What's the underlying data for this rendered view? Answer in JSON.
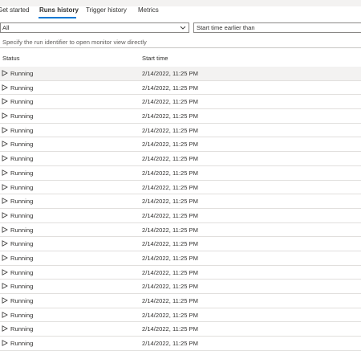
{
  "tabs": [
    {
      "label": "Get started"
    },
    {
      "label": "Runs history"
    },
    {
      "label": "Trigger history"
    },
    {
      "label": "Metrics"
    }
  ],
  "filters": {
    "status_value": "All",
    "time_placeholder": "Start time earlier than",
    "run_id_placeholder": "Specify the run identifier to open monitor view directly"
  },
  "table": {
    "columns": [
      "Status",
      "Start time"
    ],
    "rows": [
      {
        "status": "Running",
        "start_time": "2/14/2022, 11:25 PM"
      },
      {
        "status": "Running",
        "start_time": "2/14/2022, 11:25 PM"
      },
      {
        "status": "Running",
        "start_time": "2/14/2022, 11:25 PM"
      },
      {
        "status": "Running",
        "start_time": "2/14/2022, 11:25 PM"
      },
      {
        "status": "Running",
        "start_time": "2/14/2022, 11:25 PM"
      },
      {
        "status": "Running",
        "start_time": "2/14/2022, 11:25 PM"
      },
      {
        "status": "Running",
        "start_time": "2/14/2022, 11:25 PM"
      },
      {
        "status": "Running",
        "start_time": "2/14/2022, 11:25 PM"
      },
      {
        "status": "Running",
        "start_time": "2/14/2022, 11:25 PM"
      },
      {
        "status": "Running",
        "start_time": "2/14/2022, 11:25 PM"
      },
      {
        "status": "Running",
        "start_time": "2/14/2022, 11:25 PM"
      },
      {
        "status": "Running",
        "start_time": "2/14/2022, 11:25 PM"
      },
      {
        "status": "Running",
        "start_time": "2/14/2022, 11:25 PM"
      },
      {
        "status": "Running",
        "start_time": "2/14/2022, 11:25 PM"
      },
      {
        "status": "Running",
        "start_time": "2/14/2022, 11:25 PM"
      },
      {
        "status": "Running",
        "start_time": "2/14/2022, 11:25 PM"
      },
      {
        "status": "Running",
        "start_time": "2/14/2022, 11:25 PM"
      },
      {
        "status": "Running",
        "start_time": "2/14/2022, 11:25 PM"
      },
      {
        "status": "Running",
        "start_time": "2/14/2022, 11:25 PM"
      },
      {
        "status": "Running",
        "start_time": "2/14/2022, 11:25 PM"
      }
    ]
  },
  "icons": {
    "row_status": "play-icon",
    "select_chevron": "chevron-down-icon"
  },
  "colors": {
    "accent": "#0078d4",
    "selected_row": "#f3f2f1",
    "divider": "#e1dfdd"
  }
}
